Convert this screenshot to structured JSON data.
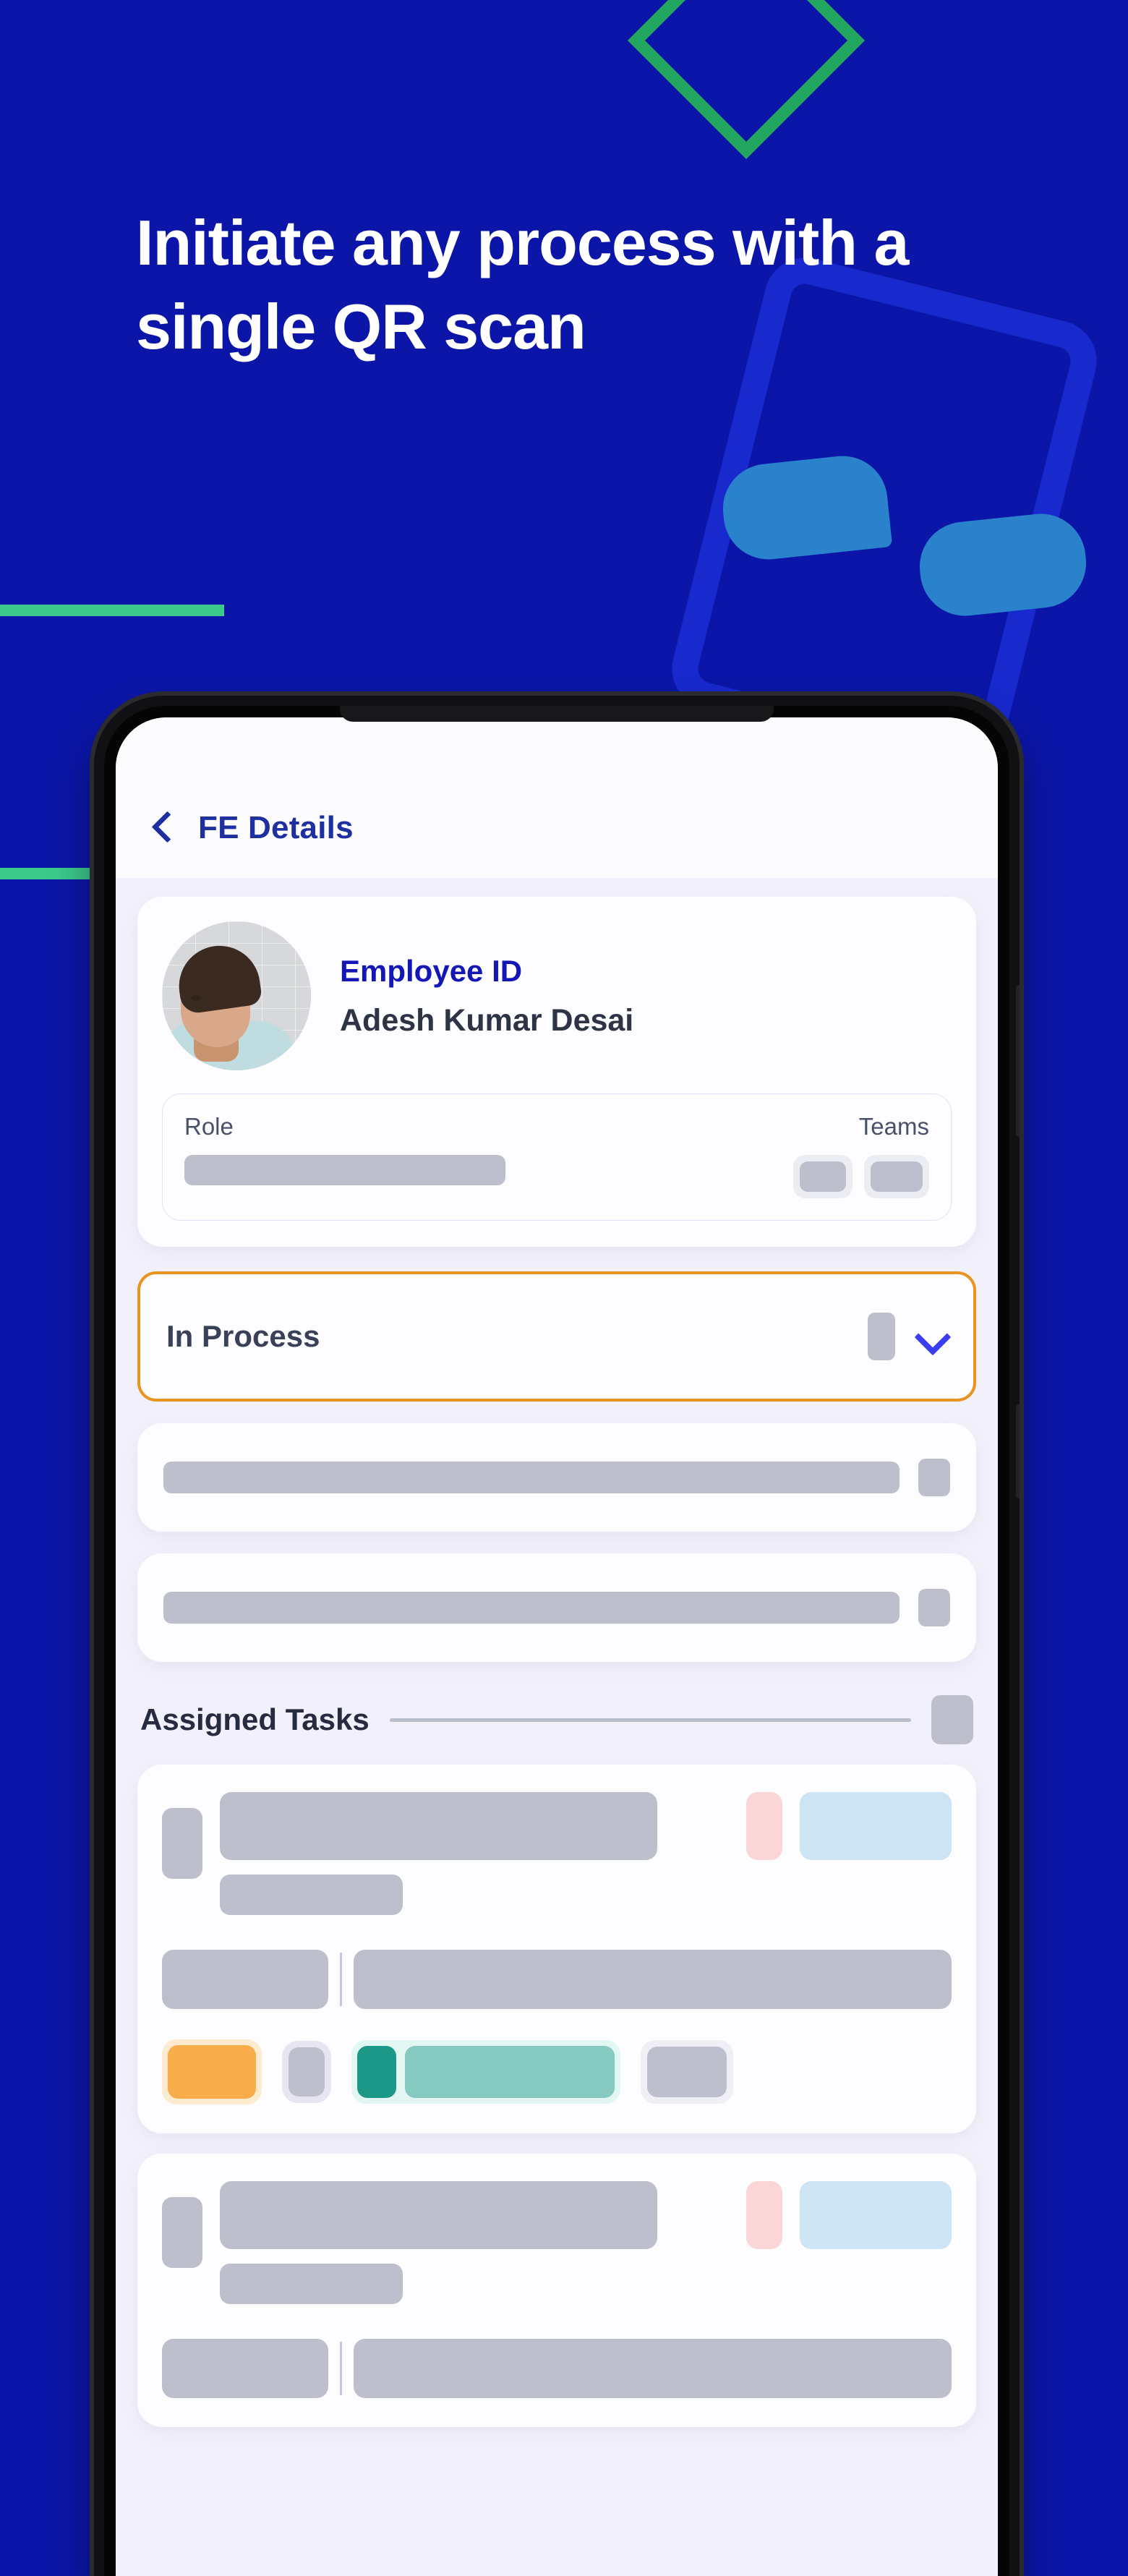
{
  "promo": {
    "headline": "Initiate any process with a single QR scan",
    "background_color": "#0B16A8",
    "accent_green": "#22A55F",
    "accent_light_green": "#3CC98C",
    "accent_blue": "#2A82CC"
  },
  "app": {
    "header": {
      "back_icon": "chevron-left-icon",
      "title": "FE Details"
    },
    "employee": {
      "id_label": "Employee ID",
      "name": "Adesh Kumar Desai",
      "avatar_alt": "employee-photo",
      "details": {
        "role_label": "Role",
        "teams_label": "Teams"
      }
    },
    "status_select": {
      "value": "In Process",
      "chevron_icon": "chevron-down-icon",
      "border_color": "#E8941E",
      "chevron_color": "#3B3DF0"
    },
    "tasks": {
      "section_title": "Assigned Tasks",
      "items": [
        {
          "pink_tag_color": "#FAD6D6",
          "blue_tag_color": "#CDE4F4",
          "orange_tag_color": "#F9AD4A",
          "teal_tag_color": "#1B9887",
          "teal_bar_color": "#85C9C0"
        },
        {
          "pink_tag_color": "#FAD6D6",
          "blue_tag_color": "#CDE4F4"
        }
      ]
    },
    "skeleton_rows": [
      {
        "id": "row-1"
      },
      {
        "id": "row-2"
      }
    ],
    "colors": {
      "screen_bg": "#F2F1FB",
      "card_bg": "#FDFDFF",
      "primary_blue": "#1E2FA0",
      "id_blue": "#1516B6",
      "text_dark": "#2E3445",
      "skeleton_grey": "#BDBFCC"
    }
  }
}
